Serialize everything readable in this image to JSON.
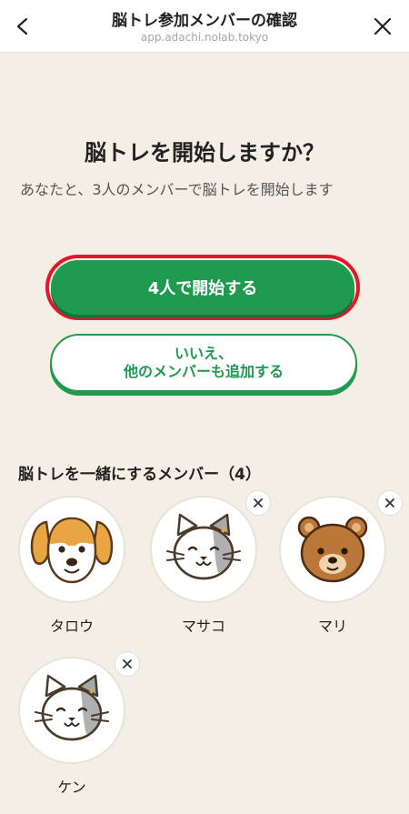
{
  "header": {
    "title": "脳トレ参加メンバーの確認",
    "url": "app.adachi.nolab.tokyo",
    "back_icon": "chevron-left-icon",
    "close_icon": "close-icon"
  },
  "main": {
    "title": "脳トレを開始しますか？",
    "subtitle": "あなたと、3人のメンバーで脳トレを開始します",
    "primary_button": "4人で開始する",
    "secondary_button_line1": "いいえ、",
    "secondary_button_line2": "他のメンバーも追加する"
  },
  "members_section": {
    "title": "脳トレを一緒にするメンバー（4）",
    "members": [
      {
        "name": "タロウ",
        "avatar": "dog-icon",
        "removable": false
      },
      {
        "name": "マサコ",
        "avatar": "cat-icon",
        "removable": true
      },
      {
        "name": "マリ",
        "avatar": "bear-icon",
        "removable": true
      },
      {
        "name": "ケン",
        "avatar": "cat-icon",
        "removable": true
      }
    ]
  },
  "colors": {
    "background": "#f4efe4",
    "primary": "#1f9a4e",
    "highlight": "#e5152a"
  }
}
